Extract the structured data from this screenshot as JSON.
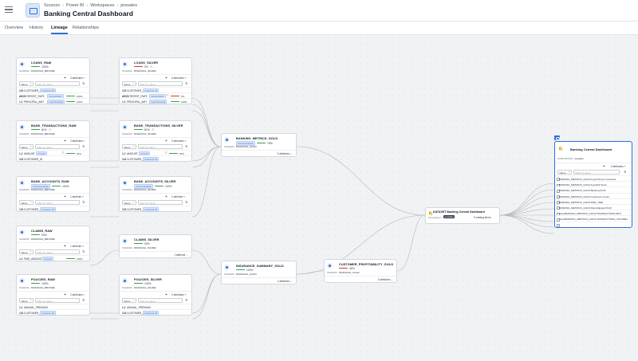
{
  "header": {
    "breadcrumbs": [
      "Sources",
      "Power BI",
      "Workspaces",
      "presales"
    ],
    "title": "Banking Central Dashboard"
  },
  "tabs": [
    "Overview",
    "History",
    "Lineage",
    "Relationships"
  ],
  "active_tab": "Lineage",
  "colors": {
    "accent": "#2f6fd6",
    "good": "#3aa14a",
    "bad": "#d63b2f",
    "warn": "#d97706"
  },
  "labels": {
    "schema": "SCHEMA",
    "filter_placeholder": "Filter by name",
    "sort_select": "Name",
    "dataset_owner": "Groupadmin",
    "dataset_owner_value": "presales",
    "workspace_label": "WORKSPACE",
    "workspace_value": "presales"
  },
  "nodes": {
    "loans_raw": {
      "title": "LOANS_RAW",
      "quality": "100%",
      "schema": "FINANCIAL_BRONZE",
      "attrs": "3 attributes",
      "rows": [
        {
          "type": "123",
          "name": "CUSTOMER_ID",
          "chip": "Customer ID",
          "pct": ""
        },
        {
          "type": "ABC",
          "name": "INTEREST_RATE",
          "chip": "Interest Rate",
          "pct": "100%"
        },
        {
          "type": "1.2",
          "name": "PRINCIPAL_AMT",
          "chip": "Loan Principal",
          "pct": "100%"
        }
      ]
    },
    "loans_silver": {
      "title": "LOANS_SILVER",
      "quality": "0%",
      "schema": "FINANCIAL_SILVER",
      "attrs": "3 attributes",
      "rows": [
        {
          "type": "123",
          "name": "CUSTOMER_ID",
          "chip": "Customer ID",
          "pct": ""
        },
        {
          "type": "ABC",
          "name": "INTEREST_RATE",
          "chip": "Interest Rate",
          "pct": "0%"
        },
        {
          "type": "1.2",
          "name": "PRINCIPAL_AMT",
          "chip": "Loan Principal",
          "pct": "100%"
        }
      ]
    },
    "bank_tx_raw": {
      "title": "BANK_TRANSACTIONS_RAW",
      "quality": "81%",
      "schema": "FINANCIAL_BRONZE",
      "attrs": "2 attributes",
      "rows": [
        {
          "type": "1.2",
          "name": "AMOUNT",
          "chip": "Amount",
          "pct": "50%"
        },
        {
          "type": "123",
          "name": "CUSTOMER_ID",
          "chip": "",
          "pct": ""
        }
      ]
    },
    "bank_tx_silver": {
      "title": "BANK_TRANSACTIONS_SILVER",
      "quality": "81%",
      "schema": "FINANCIAL_SILVER",
      "attrs": "2 attributes",
      "rows": [
        {
          "type": "1.2",
          "name": "AMOUNT",
          "chip": "Amount",
          "pct": "50%"
        },
        {
          "type": "123",
          "name": "CUSTOMER_ID",
          "chip": "Customer ID",
          "pct": ""
        }
      ]
    },
    "bank_acc_raw": {
      "title": "BANK_ACCOUNTS_RAW",
      "chip": "Personal Data",
      "quality": "100%",
      "schema": "FINANCIAL_BRONZE",
      "attrs": "1 attribute",
      "rows": [
        {
          "type": "123",
          "name": "CUSTOMER_ID",
          "chip": "Customer ID",
          "pct": ""
        }
      ]
    },
    "bank_acc_silver": {
      "title": "BANK_ACCOUNTS_SILVER",
      "chip": "Personal Data",
      "quality": "100%",
      "schema": "FINANCIAL_SILVER",
      "attrs": "1 attribute",
      "rows": [
        {
          "type": "123",
          "name": "CUSTOMER_ID",
          "chip": "Customer ID",
          "pct": ""
        }
      ]
    },
    "claims_raw": {
      "title": "CLAIMS_RAW",
      "quality": "94%",
      "schema": "FINANCIAL_BRONZE",
      "attrs": "1 attribute",
      "rows": [
        {
          "type": "1.2",
          "name": "PAID_AMOUNT",
          "chip": "Amount",
          "pct": "100%"
        }
      ]
    },
    "claims_silver": {
      "title": "CLAIMS_SILVER",
      "quality": "94%",
      "schema": "FINANCIAL_SILVER",
      "attrs": "1 attribute"
    },
    "policies_raw": {
      "title": "POLICIES_RAW",
      "quality": "100%",
      "schema": "FINANCIAL_BRONZE",
      "attrs": "2 attributes",
      "rows": [
        {
          "type": "1.2",
          "name": "ANNUAL_PREMIUM",
          "chip": "",
          "pct": ""
        },
        {
          "type": "123",
          "name": "CUSTOMER_ID",
          "chip": "Customer ID",
          "pct": ""
        }
      ]
    },
    "policies_silver": {
      "title": "POLICIES_SILVER",
      "quality": "100%",
      "schema": "FINANCIAL_SILVER",
      "attrs": "2 attributes",
      "rows": [
        {
          "type": "1.2",
          "name": "ANNUAL_PREMIUM",
          "chip": "",
          "pct": ""
        },
        {
          "type": "123",
          "name": "CUSTOMER_ID",
          "chip": "Customer ID",
          "pct": ""
        }
      ]
    },
    "banking_gold": {
      "title": "BANKING_METRICS_GOLD",
      "chip": "Personal Data",
      "quality": "78%",
      "schema": "FINANCIAL_GOLD",
      "attrs": "5 attributes"
    },
    "insurance_gold": {
      "title": "INSURANCE_SUMMARY_GOLD",
      "quality": "100%",
      "schema": "FINANCIAL_GOLD",
      "attrs": "2 attributes"
    },
    "customer_gold": {
      "title": "CUSTOMER_PROFITABILITY_GOLD",
      "quality": "46%",
      "schema": "FINANCIAL_GOLD",
      "attrs": "3 attributes"
    },
    "dataset": {
      "title": "DATASET Banking Central Dashboard",
      "attrs": "9 catalog items"
    },
    "dashboard": {
      "title": "Banking Central Dashboard",
      "attrs": "9 attributes",
      "rows": [
        "BANKING_METRICS_GOLD Avg Profit per Customer",
        "BANKING_METRICS_GOLD Avg Risk Score",
        "BANKING_METRICS_GOLD Banking Profit",
        "BANKING_METRICS_GOLD Customers Count",
        "BANKING_METRICS_GOLD RISK_TIER",
        "BANKING_METRICS_GOLD Risk Adjusted Profit",
        "Sum(BANKING_METRICS_GOLD.TRANSACTIONS.NET)",
        "Sum(BANKING_METRICS_GOLD.TRANSACTIONS_VOLUME)",
        ""
      ]
    }
  }
}
